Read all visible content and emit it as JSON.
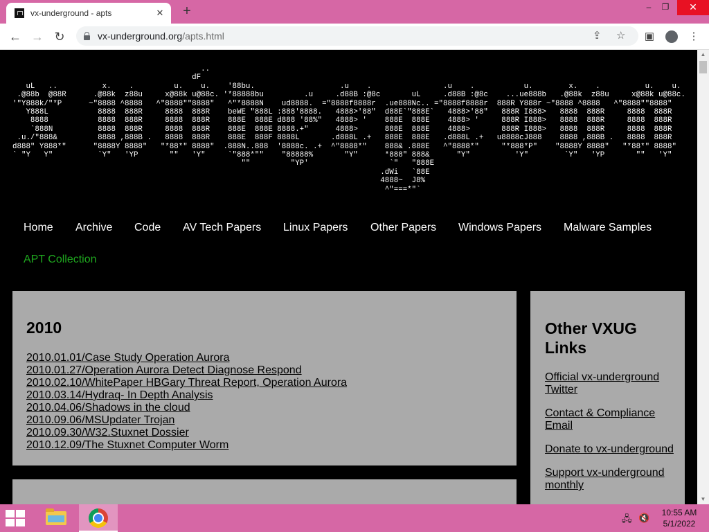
{
  "browser": {
    "tab_title": "vx-underground - apts",
    "tab_close": "✕",
    "new_tab": "+",
    "url_host": "vx-underground.org",
    "url_path": "/apts.html",
    "window_controls": {
      "minimize": "–",
      "restore": "❐",
      "close": "✕"
    }
  },
  "page": {
    "ascii_banner": "                                          ..\n                                        dF\n   uL   ..          x.    .         u.    u.    '88bu.                   .u    .                .u    .           u.        x.    .          u.    u.\n .@88b  @88R      .@88k  z88u     x@88k u@88c. '*88888bu         .u     .d88B :@8c       uL     .d88B :@8c    ...ue888b   .@88k  z88u     x@88k u@88c.\n'\"Y888k/\"*P      ~\"8888 ^8888   ^\"8888\"\"8888\"   ^\"*8888N    ud8888.  =\"8888f8888r  .ue888Nc.. =\"8888f8888r  888R Y888r ~\"8888 ^8888   ^\"8888\"\"8888\"\n   Y888L           8888  888R     8888  888R    beWE \"888L :888'8888.   4888>'88\"  d88E`\"888E`   4888>'88\"   888R I888>   8888  888R     8888  888R\n    8888           8888  888R     8888  888R    888E  888E d888 '88%\"   4888> '    888E  888E    4888> '     888R I888>   8888  888R     8888  888R\n    `888N          8888  888R     8888  888R    888E  888E 8888.+\"      4888>      888E  888E    4888>       888R I888>   8888  888R     8888  888R\n .u./\"888&         8888 ,888B .   8888  888R    888E  888F 8888L       .d888L .+   888E  888E   .d888L .+   u8888cJ888    8888 ,888B .   8888  888R\nd888\" Y888*\"      \"8888Y 8888\"   \"*88*\" 8888\"  .888N..888  '8888c. .+  ^\"8888*\"    888& .888E   ^\"8888*\"     \"*888*P\"    \"8888Y 8888\"   \"*88*\" 8888\"\n` \"Y   Y\"          `Y\"   'YP       \"\"   'Y\"     `\"888*\"\"    \"88888%       \"Y\"      *888\" 888&      \"Y\"          'Y\"        `Y\"   'YP       \"\"   'Y\"\n                                                   \"\"         \"YP'                  `\"   \"888E\n                                                                                  .dWi   `88E\n                                                                                  4888~  J8%\n                                                                                   ^\"===*\"`",
    "nav": [
      {
        "label": "Home"
      },
      {
        "label": "Archive"
      },
      {
        "label": "Code"
      },
      {
        "label": "AV Tech Papers"
      },
      {
        "label": "Linux Papers"
      },
      {
        "label": "Other Papers"
      },
      {
        "label": "Windows Papers"
      },
      {
        "label": "Malware Samples"
      },
      {
        "label": "APT Collection"
      }
    ],
    "year_section": {
      "title": "2010",
      "items": [
        "2010.01.01/Case Study Operation Aurora",
        "2010.01.27/Operation Aurora Detect Diagnose Respond",
        "2010.02.10/WhitePaper HBGary Threat Report, Operation Aurora",
        "2010.03.14/Hydraq- In Depth Analysis",
        "2010.04.06/Shadows in the cloud",
        "2010.09.06/MSUpdater Trojan",
        "2010.09.30/W32.Stuxnet Dossier",
        "2010.12.09/The Stuxnet Computer Worm"
      ]
    },
    "sidebar": {
      "title": "Other VXUG Links",
      "links": [
        "Official vx-underground Twitter",
        "Contact & Compliance Email",
        "Donate to vx-underground",
        "Support vx-underground monthly"
      ]
    }
  },
  "taskbar": {
    "time": "10:55 AM",
    "date": "5/1/2022"
  },
  "colors": {
    "accent_pink": "#d667a5",
    "active_nav_green": "#1fa81f",
    "card_gray": "#aaaaaa"
  }
}
